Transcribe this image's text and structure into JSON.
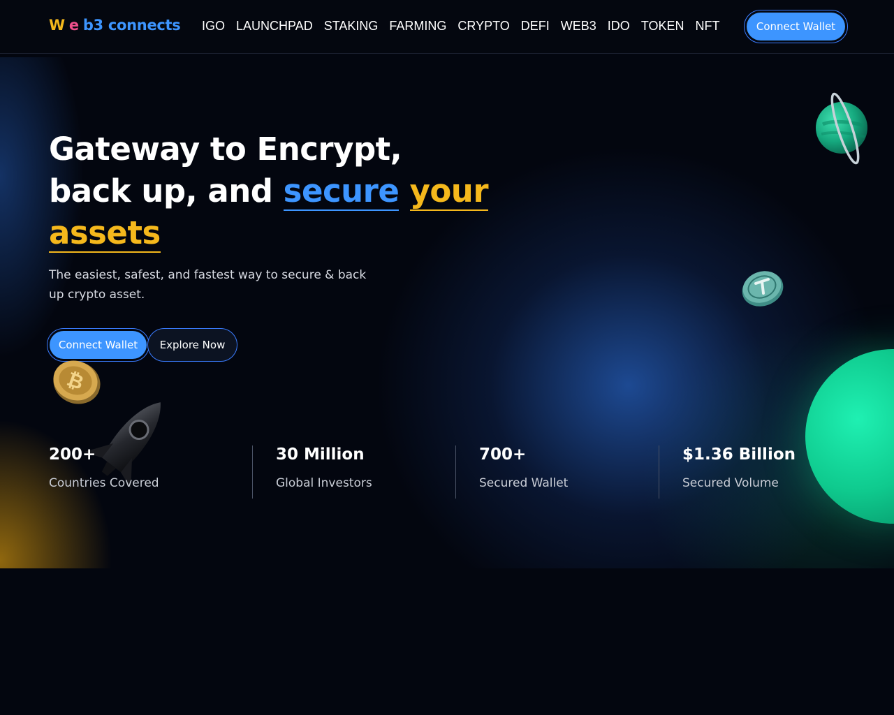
{
  "logo": {
    "part1": "W",
    "part2": "e",
    "part3": "b3 connects"
  },
  "nav": {
    "items": [
      "IGO",
      "LAUNCHPAD",
      "STAKING",
      "FARMING",
      "CRYPTO",
      "DEFI",
      "WEB3",
      "IDO",
      "TOKEN",
      "NFT"
    ]
  },
  "header": {
    "connect_label": "Connect Wallet"
  },
  "hero": {
    "title_line1": "Gateway to Encrypt,",
    "title_line2": "back up, and",
    "title_highlight_blue": "secure",
    "title_highlight_yellow_1": "your",
    "title_highlight_yellow_2": "assets",
    "subtitle": "The easiest, safest, and fastest way to secure & back up crypto asset.",
    "connect_label": "Connect Wallet",
    "explore_label": "Explore Now"
  },
  "stats": [
    {
      "value": "200+",
      "label": "Countries Covered"
    },
    {
      "value": "30 Million",
      "label": "Global Investors"
    },
    {
      "value": "700+",
      "label": "Secured Wallet"
    },
    {
      "value": "$1.36 Billion",
      "label": "Secured Volume"
    }
  ],
  "colors": {
    "accent_blue": "#3d95ff",
    "accent_yellow": "#f5b81c",
    "logo_pink": "#ef4f8c",
    "planet_green": "#0fca8e",
    "background": "#03060f"
  },
  "icons": {
    "planet": "ringed-planet-icon",
    "teal_coin": "tether-coin-icon",
    "gold_coin": "bitcoin-coin-icon",
    "rocket": "rocket-icon",
    "big_planet": "green-planet-icon"
  }
}
